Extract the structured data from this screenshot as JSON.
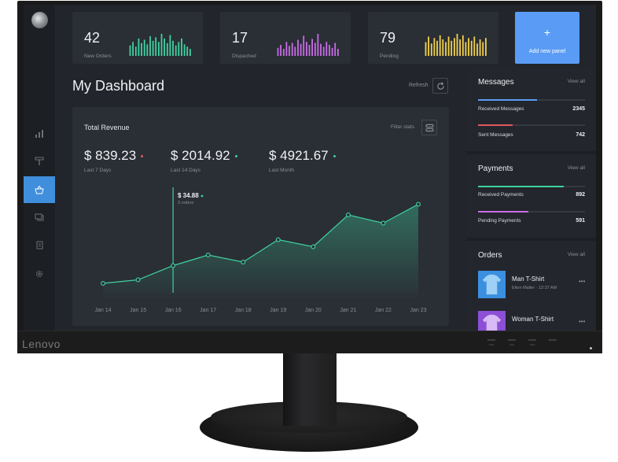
{
  "monitor": {
    "brand": "Lenovo"
  },
  "sidebar": {
    "items": [
      {
        "icon": "bar-chart-icon",
        "active": false
      },
      {
        "icon": "paint-roller-icon",
        "active": false
      },
      {
        "icon": "basket-icon",
        "active": true
      },
      {
        "icon": "chat-icon",
        "active": false
      },
      {
        "icon": "documents-icon",
        "active": false
      },
      {
        "icon": "gear-icon",
        "active": false
      }
    ]
  },
  "stats": [
    {
      "value": "42",
      "label": "New Orders",
      "color": "#3ed3a0",
      "bars": [
        9,
        12,
        8,
        15,
        11,
        14,
        10,
        17,
        13,
        16,
        12,
        19,
        15,
        11,
        18,
        13,
        9,
        12,
        15,
        10,
        8,
        6
      ]
    },
    {
      "value": "17",
      "label": "Dispached",
      "color": "#c86de8",
      "bars": [
        8,
        11,
        7,
        14,
        10,
        13,
        9,
        16,
        12,
        20,
        14,
        11,
        17,
        13,
        22,
        12,
        9,
        14,
        11,
        8,
        13,
        7
      ]
    },
    {
      "value": "79",
      "label": "Pending",
      "color": "#f2d24b",
      "bars": [
        10,
        14,
        9,
        13,
        11,
        15,
        12,
        10,
        14,
        11,
        13,
        16,
        12,
        15,
        10,
        13,
        11,
        14,
        9,
        12,
        10,
        13
      ]
    }
  ],
  "add_panel": {
    "plus": "+",
    "label": "Add new panel"
  },
  "dashboard": {
    "title": "My Dashboard",
    "refresh_label": "Refresh"
  },
  "revenue": {
    "title": "Total Revenue",
    "filter_label": "Filter stats",
    "kpis": [
      {
        "value": "$ 839.23",
        "label": "Last 7 Days",
        "dot_color": "#e05a5a"
      },
      {
        "value": "$ 2014.92",
        "label": "Last 14 Days",
        "dot_color": "#3ed3a0"
      },
      {
        "value": "$ 4921.67",
        "label": "Last Month",
        "dot_color": "#3ed3a0"
      }
    ],
    "tooltip": {
      "value": "$ 34.88",
      "sub": "3 orders"
    }
  },
  "chart_data": {
    "type": "area",
    "title": "Total Revenue",
    "x": [
      "Jan 14",
      "Jan 15",
      "Jan 16",
      "Jan 17",
      "Jan 18",
      "Jan 19",
      "Jan 20",
      "Jan 21",
      "Jan 22",
      "Jan 23"
    ],
    "series": [
      {
        "values": [
          12,
          15,
          27,
          36,
          30,
          49,
          43,
          70,
          63,
          79
        ]
      }
    ],
    "ylim": [
      0,
      100
    ],
    "highlight_index": 2,
    "line_color": "#3ed3a0",
    "grid": false
  },
  "messages": {
    "title": "Messages",
    "view_all": "View all",
    "rows": [
      {
        "label": "Received Messages",
        "value": "2345",
        "fill": 0.55,
        "color": "#5a9cf5"
      },
      {
        "label": "Sent Messages",
        "value": "742",
        "fill": 0.32,
        "color": "#e05a5a"
      }
    ]
  },
  "payments": {
    "title": "Payments",
    "view_all": "View all",
    "rows": [
      {
        "label": "Received Payments",
        "value": "892",
        "fill": 0.8,
        "color": "#3ed3a0"
      },
      {
        "label": "Pending Payments",
        "value": "591",
        "fill": 0.47,
        "color": "#c86de8"
      }
    ]
  },
  "orders": {
    "title": "Orders",
    "view_all": "View all",
    "items": [
      {
        "name": "Man T-Shirt",
        "meta": "Elton Maller  ·  12:37 AM",
        "more": "•••",
        "color": "#3a8fe0"
      },
      {
        "name": "Woman T-Shirt",
        "meta": "",
        "more": "•••",
        "color": "#8c4fd6"
      }
    ]
  }
}
